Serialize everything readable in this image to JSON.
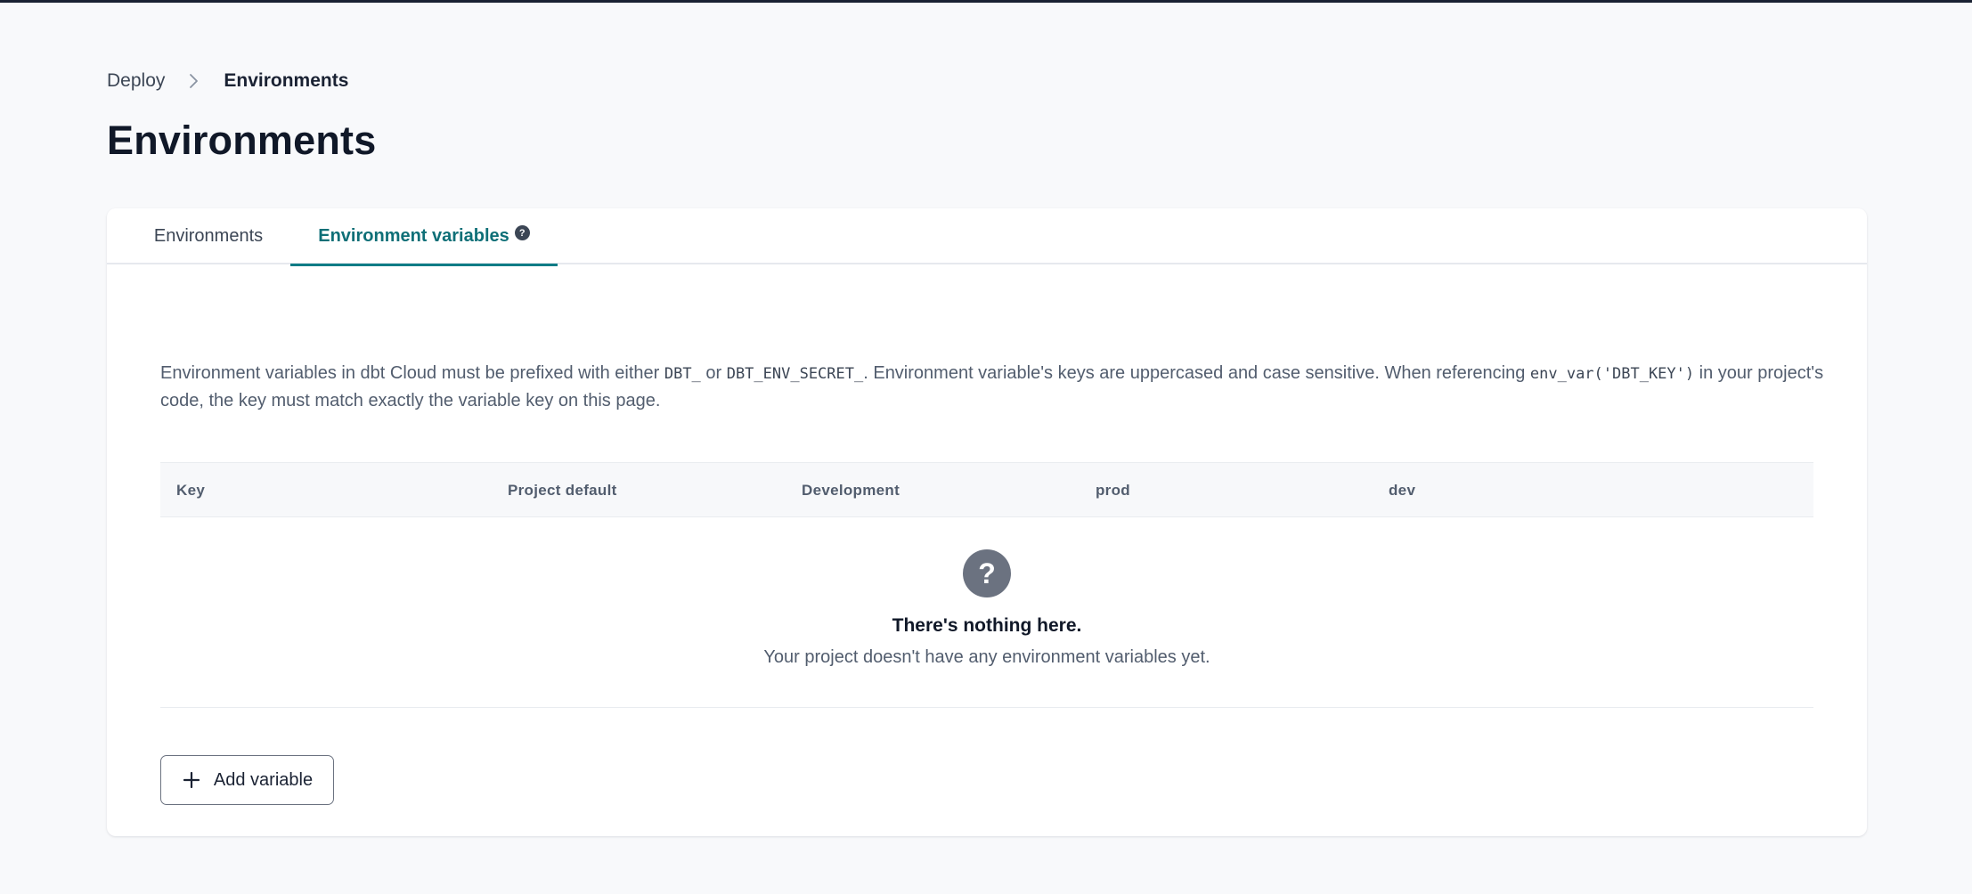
{
  "breadcrumb": {
    "parent": "Deploy",
    "current": "Environments"
  },
  "page": {
    "title": "Environments"
  },
  "tabs": [
    {
      "label": "Environments",
      "active": false
    },
    {
      "label": "Environment variables",
      "active": true
    }
  ],
  "description": {
    "part1": "Environment variables in dbt Cloud must be prefixed with either ",
    "code1": "DBT_",
    "part2": " or ",
    "code2": "DBT_ENV_SECRET_",
    "part3": ". Environment variable's keys are uppercased and case sensitive. When referencing ",
    "code3": "env_var('DBT_KEY')",
    "part4": " in your project's code, the key must match exactly the variable key on this page."
  },
  "table": {
    "columns": [
      "Key",
      "Project default",
      "Development",
      "prod",
      "dev"
    ]
  },
  "empty_state": {
    "icon": "question-icon",
    "title": "There's nothing here.",
    "subtitle": "Your project doesn't have any environment variables yet."
  },
  "actions": {
    "add_variable_label": "Add variable"
  },
  "colors": {
    "accent": "#0e7c86",
    "background": "#f8f9fb"
  }
}
